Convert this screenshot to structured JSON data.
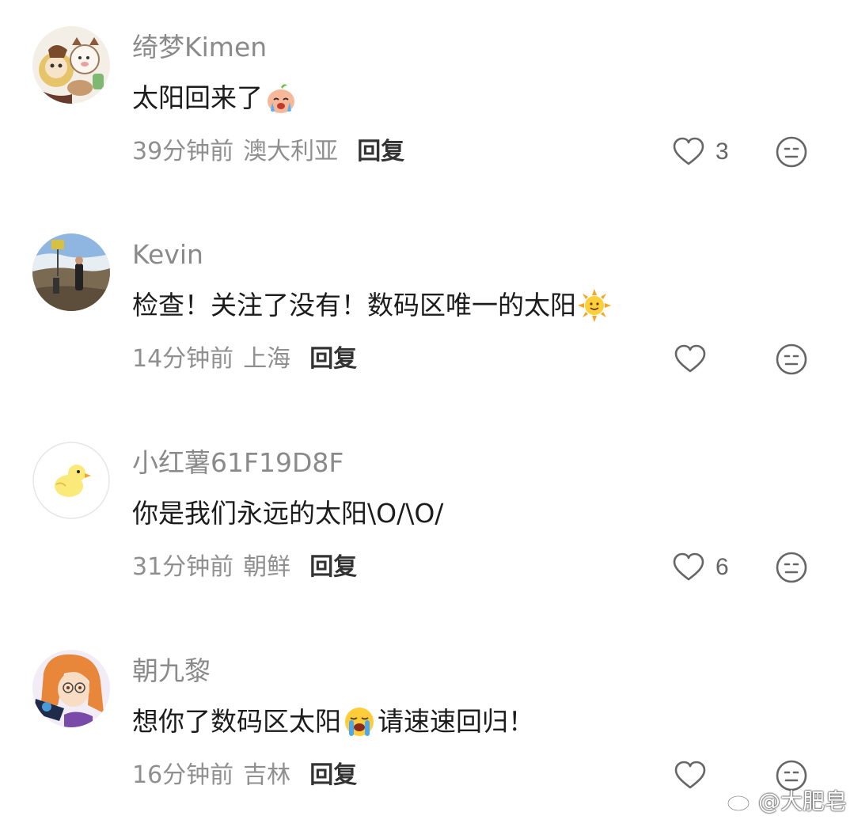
{
  "comments": [
    {
      "username": "绮梦Kimen",
      "text": "太阳回来了",
      "emoji_after": "crying-face-emoji",
      "time": "39分钟前",
      "location": "澳大利亚",
      "reply_label": "回复",
      "likes": "3"
    },
    {
      "username": "Kevin",
      "text": "检查！关注了没有！数码区唯一的太阳",
      "emoji_after": "sun-emoji",
      "time": "14分钟前",
      "location": "上海",
      "reply_label": "回复",
      "likes": ""
    },
    {
      "username": "小红薯61F19D8F",
      "text": "你是我们永远的太阳\\O/\\O/",
      "time": "31分钟前",
      "location": "朝鲜",
      "reply_label": "回复",
      "likes": "6"
    },
    {
      "username": "朝九黎",
      "text_before": "想你了数码区太阳",
      "emoji_mid": "loudly-crying-emoji",
      "text_after": "请速速回归！",
      "time": "16分钟前",
      "location": "吉林",
      "reply_label": "回复",
      "likes": ""
    }
  ],
  "watermark": {
    "text": "@大肥皂",
    "icon": "weibo-icon"
  },
  "colors": {
    "username": "#8a8a8a",
    "meta": "#8f8f8f",
    "text": "#1c1c1c",
    "icon": "#666666"
  }
}
